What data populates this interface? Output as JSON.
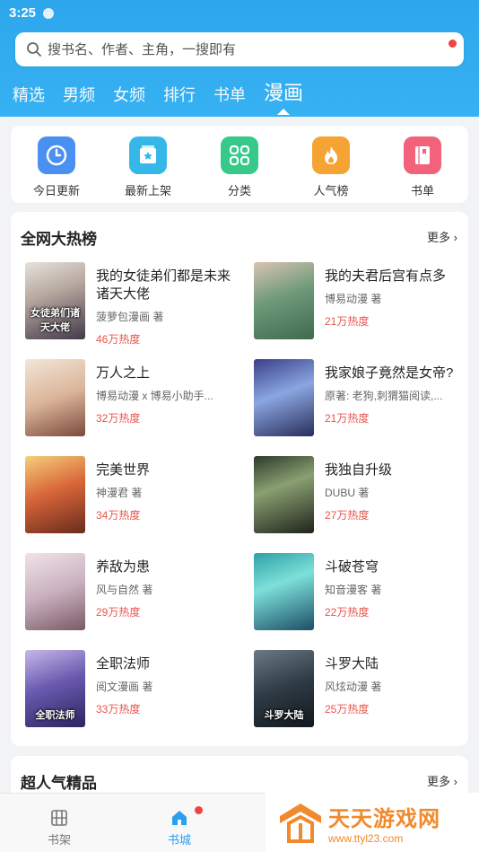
{
  "status_bar": {
    "time": "3:25"
  },
  "search": {
    "placeholder": "搜书名、作者、主角，一搜即有"
  },
  "tabs": [
    {
      "label": "精选"
    },
    {
      "label": "男频"
    },
    {
      "label": "女频"
    },
    {
      "label": "排行"
    },
    {
      "label": "书单"
    },
    {
      "label": "漫画",
      "active": true
    }
  ],
  "quick_links": [
    {
      "label": "今日更新",
      "icon": "clock-icon",
      "color": "#4a90f0"
    },
    {
      "label": "最新上架",
      "icon": "new-shelf-icon",
      "color": "#35b8e8"
    },
    {
      "label": "分类",
      "icon": "category-icon",
      "color": "#35c98a"
    },
    {
      "label": "人气榜",
      "icon": "flame-icon",
      "color": "#f5a332"
    },
    {
      "label": "书单",
      "icon": "booklist-icon",
      "color": "#f2627a"
    }
  ],
  "hot_list": {
    "title": "全网大热榜",
    "more": "更多",
    "books": [
      {
        "title": "我的女徒弟们都是未来诸天大佬",
        "author": "菠萝包漫画 著",
        "heat": "46万热度",
        "cover_text": "女徒弟们诸天大佬"
      },
      {
        "title": "我的夫君后宫有点多",
        "author": "博易动漫 著",
        "heat": "21万热度",
        "cover_text": ""
      },
      {
        "title": "万人之上",
        "author": "博易动漫 x 博易小助手...",
        "heat": "32万热度",
        "cover_text": ""
      },
      {
        "title": "我家娘子竟然是女帝?",
        "author": "原著: 老狗,刺猬猫阅读,...",
        "heat": "21万热度",
        "cover_text": ""
      },
      {
        "title": "完美世界",
        "author": "神漫君 著",
        "heat": "34万热度",
        "cover_text": ""
      },
      {
        "title": "我独自升级",
        "author": "DUBU 著",
        "heat": "27万热度",
        "cover_text": ""
      },
      {
        "title": "养敌为患",
        "author": "风与自然 著",
        "heat": "29万热度",
        "cover_text": ""
      },
      {
        "title": "斗破苍穹",
        "author": "知音漫客 著",
        "heat": "22万热度",
        "cover_text": ""
      },
      {
        "title": "全职法师",
        "author": "阅文漫画 著",
        "heat": "33万热度",
        "cover_text": "全职法师"
      },
      {
        "title": "斗罗大陆",
        "author": "风炫动漫 著",
        "heat": "25万热度",
        "cover_text": "斗罗大陆"
      }
    ]
  },
  "popular": {
    "title": "超人气精品",
    "more": "更多"
  },
  "bottom_nav": [
    {
      "label": "书架",
      "icon": "bookshelf-icon"
    },
    {
      "label": "书城",
      "icon": "home-icon",
      "active": true
    }
  ],
  "watermark": {
    "name": "天天游戏网",
    "url": "www.ttyl23.com"
  },
  "colors": {
    "primary": "#2ea6ec",
    "heat": "#e8554e",
    "badge": "#ee4545"
  }
}
